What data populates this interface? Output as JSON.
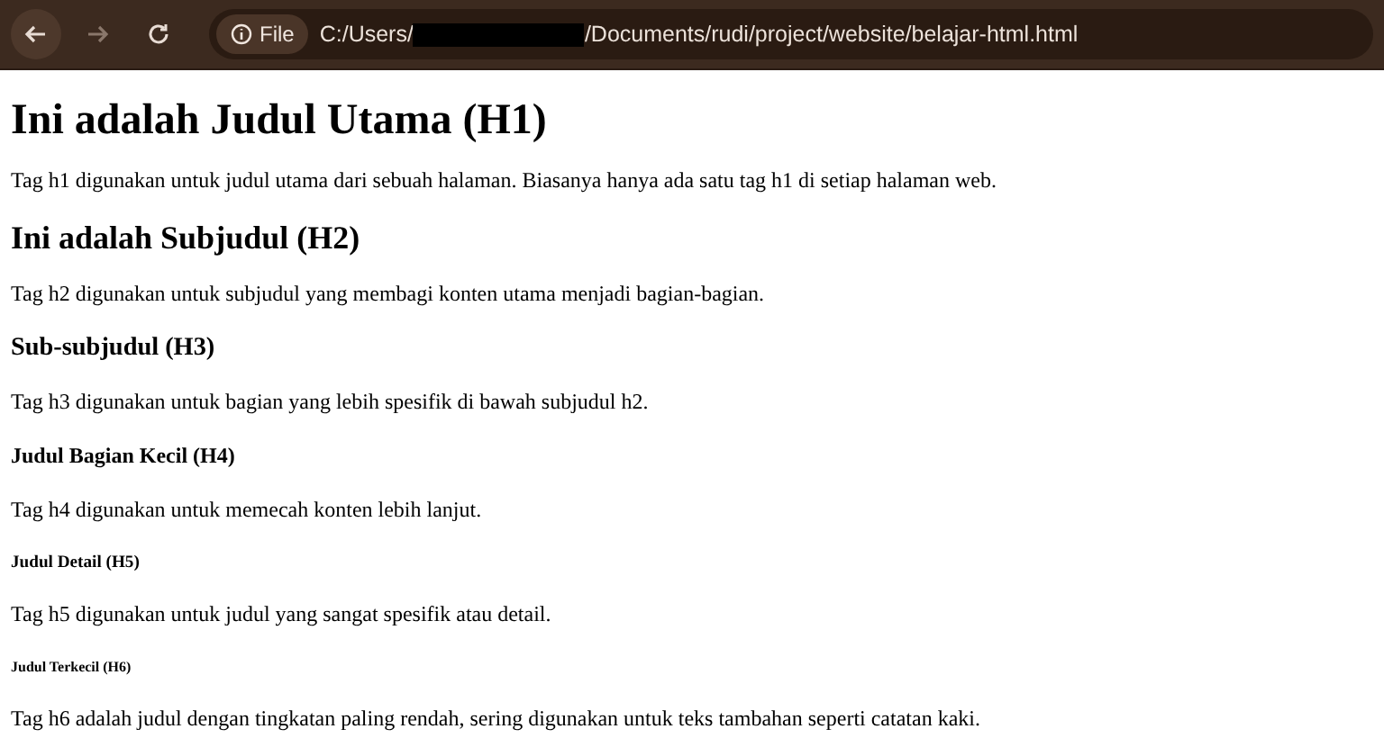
{
  "toolbar": {
    "back_disabled": false,
    "forward_disabled": true,
    "site_info": "File",
    "url_before": "C:/Users/",
    "url_redacted": true,
    "url_after": "/Documents/rudi/project/website/belajar-html.html"
  },
  "content": [
    {
      "kind": "h1",
      "text": "Ini adalah Judul Utama (H1)"
    },
    {
      "kind": "p",
      "text": "Tag h1 digunakan untuk judul utama dari sebuah halaman. Biasanya hanya ada satu tag h1 di setiap halaman web."
    },
    {
      "kind": "h2",
      "text": "Ini adalah Subjudul (H2)"
    },
    {
      "kind": "p",
      "text": "Tag h2 digunakan untuk subjudul yang membagi konten utama menjadi bagian-bagian."
    },
    {
      "kind": "h3",
      "text": "Sub-subjudul (H3)"
    },
    {
      "kind": "p",
      "text": "Tag h3 digunakan untuk bagian yang lebih spesifik di bawah subjudul h2."
    },
    {
      "kind": "h4",
      "text": "Judul Bagian Kecil (H4)"
    },
    {
      "kind": "p",
      "text": "Tag h4 digunakan untuk memecah konten lebih lanjut."
    },
    {
      "kind": "h5",
      "text": "Judul Detail (H5)"
    },
    {
      "kind": "p",
      "text": "Tag h5 digunakan untuk judul yang sangat spesifik atau detail."
    },
    {
      "kind": "h6",
      "text": "Judul Terkecil (H6)"
    },
    {
      "kind": "p",
      "text": "Tag h6 adalah judul dengan tingkatan paling rendah, sering digunakan untuk teks tambahan seperti catatan kaki."
    }
  ]
}
